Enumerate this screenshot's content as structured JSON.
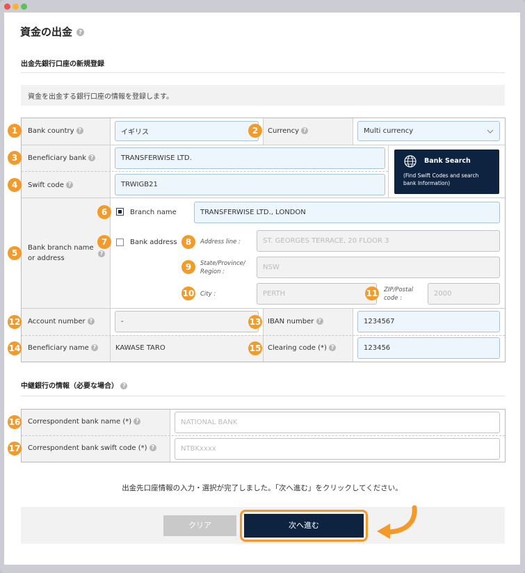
{
  "header": {
    "title": "資金の出金"
  },
  "section1": {
    "title": "出金先銀行口座の新規登録",
    "description": "資金を出金する銀行口座の情報を登録します。"
  },
  "fields": {
    "bank_country": {
      "num": "1",
      "label": "Bank country",
      "value": "イギリス"
    },
    "currency": {
      "num": "2",
      "label": "Currency",
      "value": "Multi currency"
    },
    "beneficiary_bank": {
      "num": "3",
      "label": "Beneficiary bank",
      "value": "TRANSFERWISE LTD."
    },
    "swift_code": {
      "num": "4",
      "label": "Swift code",
      "value": "TRWIGB21"
    },
    "branch_or_address": {
      "num": "5",
      "label_line1": "Bank branch name",
      "label_line2": "or address"
    },
    "branch_name": {
      "num": "6",
      "label": "Branch name",
      "value": "TRANSFERWISE LTD., LONDON",
      "checked": true
    },
    "bank_address": {
      "num": "7",
      "label": "Bank address",
      "checked": false
    },
    "address_line": {
      "num": "8",
      "label": "Address line :",
      "value": "ST. GEORGES TERRACE, 20 FLOOR 3"
    },
    "state": {
      "num": "9",
      "label_line1": "State/Province/",
      "label_line2": "Region :",
      "value": "NSW"
    },
    "city": {
      "num": "10",
      "label": "City :",
      "value": "PERTH"
    },
    "zip": {
      "num": "11",
      "label_line1": "ZIP/Postal",
      "label_line2": "code :",
      "value": "2000"
    },
    "account_number": {
      "num": "12",
      "label": "Account number",
      "value": "-"
    },
    "iban": {
      "num": "13",
      "label": "IBAN number",
      "value": "1234567"
    },
    "beneficiary_name": {
      "num": "14",
      "label": "Beneficiary name",
      "value": "KAWASE TARO"
    },
    "clearing_code": {
      "num": "15",
      "label": "Clearing code (*)",
      "value": "123456"
    }
  },
  "bank_search": {
    "title": "Bank Search",
    "line1": "(Find Swift Codes and search",
    "line2": "bank Information)"
  },
  "section2": {
    "title": "中継銀行の情報（必要な場合）",
    "correspondent_name": {
      "num": "16",
      "label": "Correspondent bank name (*)",
      "placeholder": "NATIONAL BANK"
    },
    "correspondent_swift": {
      "num": "17",
      "label": "Correspondent bank swift code (*)",
      "placeholder": "NTBKxxxx"
    }
  },
  "footer": {
    "message": "出金先口座情報の入力・選択が完了しました。「次へ進む」をクリックしてください。",
    "clear_label": "クリア",
    "next_label": "次へ進む"
  },
  "colors": {
    "accent": "#f39b2a",
    "navy": "#0d2340",
    "input_bg": "#eef6fd"
  },
  "icons": {
    "help": "question-circle-icon",
    "dropdown": "chevron-down-icon",
    "bank_search": "globe-icon",
    "pointer": "curved-arrow-icon"
  }
}
